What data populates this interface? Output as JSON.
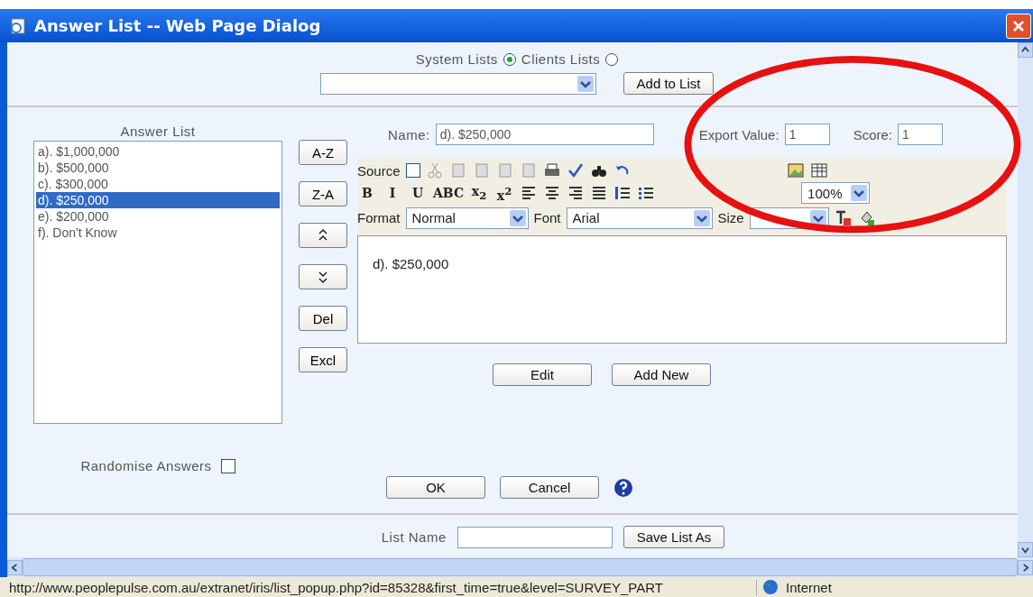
{
  "window": {
    "title": "Answer List -- Web Page Dialog"
  },
  "list_source": [
    {
      "label": "System Lists",
      "selected": true
    },
    {
      "label": "Clients Lists",
      "selected": false
    }
  ],
  "add_to_list_button": "Add to List",
  "answer_list": {
    "label": "Answer List",
    "items": [
      {
        "text": "a). $1,000,000",
        "selected": false
      },
      {
        "text": "b). $500,000",
        "selected": false
      },
      {
        "text": "c). $300,000",
        "selected": false
      },
      {
        "text": "d). $250,000",
        "selected": true
      },
      {
        "text": "e). $200,000",
        "selected": false
      },
      {
        "text": "f). Don't Know",
        "selected": false
      }
    ]
  },
  "order_buttons": [
    {
      "kind": "text",
      "label": "A-Z"
    },
    {
      "kind": "text",
      "label": "Z-A"
    },
    {
      "kind": "up"
    },
    {
      "kind": "down"
    },
    {
      "kind": "text",
      "label": "Del"
    },
    {
      "kind": "text",
      "label": "Excl"
    }
  ],
  "randomise": {
    "label": "Randomise Answers",
    "checked": false
  },
  "name_field": {
    "label": "Name:",
    "value": "d). $250,000"
  },
  "export_value": {
    "label": "Export Value:",
    "value": "1"
  },
  "score": {
    "label": "Score:",
    "value": "1"
  },
  "editor": {
    "source_label": "Source",
    "source_checked": false,
    "format_buttons": [
      "B",
      "I",
      "U",
      "ABC",
      "x$_{2}$",
      "x$^{2}$"
    ],
    "zoom_value": "100%",
    "format_label": "Format",
    "format_value": "Normal",
    "font_label": "Font",
    "font_value": "Arial",
    "size_label": "Size",
    "content": "d). $250,000"
  },
  "edit_buttons": [
    "Edit",
    "Add New"
  ],
  "dialog_buttons": [
    "OK",
    "Cancel"
  ],
  "list_name": {
    "label": "List Name",
    "button": "Save List As"
  },
  "status_bar": {
    "url": "http://www.peoplepulse.com.au/extranet/iris/list_popup.php?id=85328&first_time=true&level=SURVEY_PART",
    "zone": "Internet"
  }
}
